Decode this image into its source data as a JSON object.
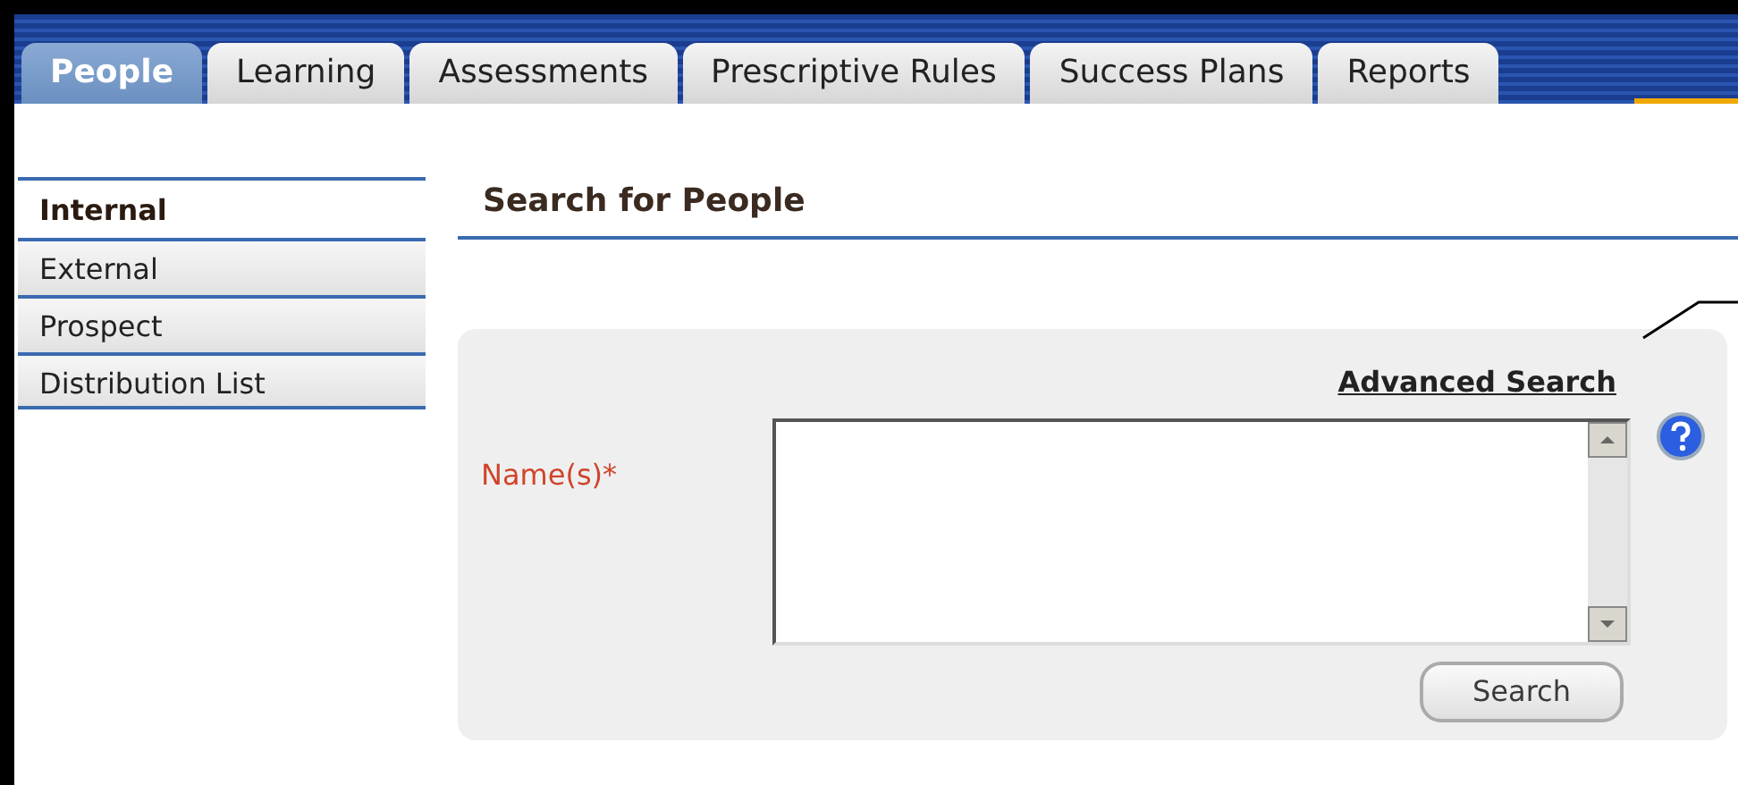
{
  "tabs": [
    {
      "label": "People",
      "selected": true
    },
    {
      "label": "Learning",
      "selected": false
    },
    {
      "label": "Assessments",
      "selected": false
    },
    {
      "label": "Prescriptive Rules",
      "selected": false
    },
    {
      "label": "Success Plans",
      "selected": false
    },
    {
      "label": "Reports",
      "selected": false
    }
  ],
  "sidebar": {
    "items": [
      {
        "label": "Internal",
        "selected": true
      },
      {
        "label": "External",
        "selected": false
      },
      {
        "label": "Prospect",
        "selected": false
      },
      {
        "label": "Distribution List",
        "selected": false
      }
    ]
  },
  "page_title": "Search for People",
  "search_panel": {
    "advanced_link": "Advanced Search",
    "field_label": "Name(s)*",
    "button": "Search"
  }
}
